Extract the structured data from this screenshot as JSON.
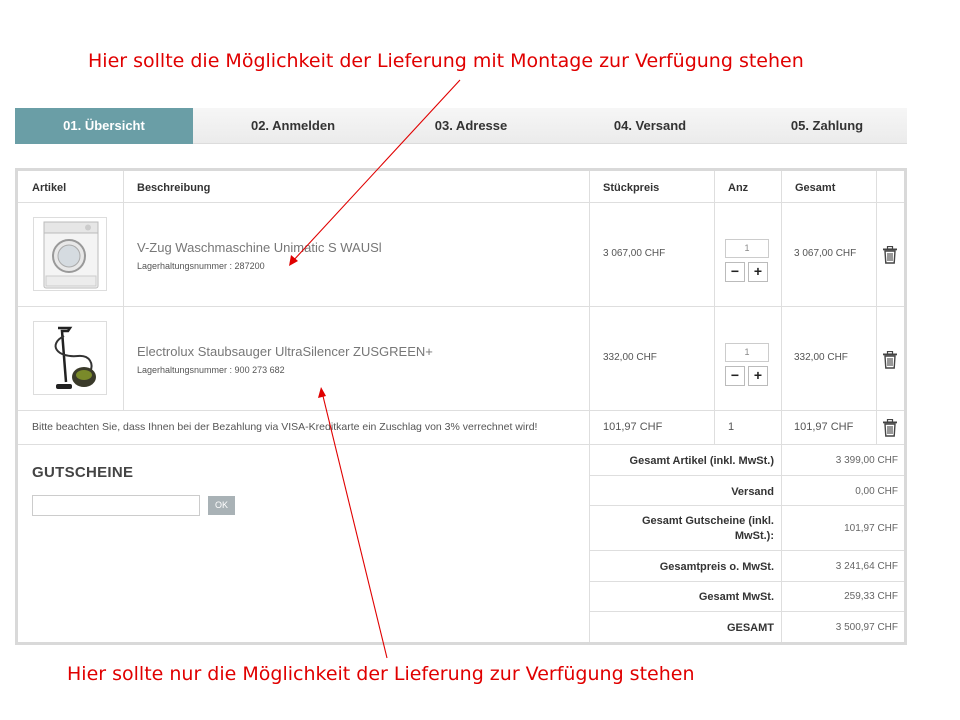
{
  "annotations": {
    "top": "Hier sollte die Möglichkeit der Lieferung mit Montage zur Verfügung stehen",
    "bottom": "Hier sollte nur die Möglichkeit der Lieferung zur Verfügung stehen"
  },
  "steps": [
    {
      "label": "01. Übersicht",
      "active": true
    },
    {
      "label": "02. Anmelden",
      "active": false
    },
    {
      "label": "03. Adresse",
      "active": false
    },
    {
      "label": "04. Versand",
      "active": false
    },
    {
      "label": "05. Zahlung",
      "active": false
    }
  ],
  "table": {
    "headers": {
      "artikel": "Artikel",
      "beschreibung": "Beschreibung",
      "stueckpreis": "Stückpreis",
      "anz": "Anz",
      "gesamt": "Gesamt"
    },
    "items": [
      {
        "name": "V-Zug Waschmaschine Unimatic S WAUSl",
        "sku": "Lagerhaltungsnummer : 287200",
        "price": "3 067,00 CHF",
        "qty": "1",
        "total": "3 067,00 CHF",
        "image": "washing-machine-image"
      },
      {
        "name": "Electrolux Staubsauger UltraSilencer ZUSGREEN+",
        "sku": "Lagerhaltungsnummer : 900 273 682",
        "price": "332,00 CHF",
        "qty": "1",
        "total": "332,00 CHF",
        "image": "vacuum-cleaner-image"
      }
    ],
    "surcharge": {
      "note": "Bitte beachten Sie, dass Ihnen bei der Bezahlung via VISA-Kreditkarte ein Zuschlag von 3% verrechnet wird!",
      "price": "101,97 CHF",
      "qty": "1",
      "total": "101,97 CHF"
    },
    "qty_minus": "−",
    "qty_plus": "+"
  },
  "voucher": {
    "title": "GUTSCHEINE",
    "input_value": "",
    "ok_label": "OK"
  },
  "summary": [
    {
      "label": "Gesamt Artikel (inkl. MwSt.)",
      "value": "3 399,00 CHF"
    },
    {
      "label": "Versand",
      "value": "0,00 CHF"
    },
    {
      "label": "Gesamt Gutscheine (inkl.",
      "label2": "MwSt.):",
      "value": "101,97 CHF"
    },
    {
      "label": "Gesamtpreis o. MwSt.",
      "value": "3 241,64 CHF"
    },
    {
      "label": "Gesamt MwSt.",
      "value": "259,33 CHF"
    },
    {
      "label": "GESAMT",
      "value": "3 500,97 CHF"
    }
  ],
  "colors": {
    "active_step": "#6a9ea6",
    "annotation": "#e00000",
    "ok_button": "#a9b2b6"
  },
  "icons": [
    "trash-icon"
  ]
}
